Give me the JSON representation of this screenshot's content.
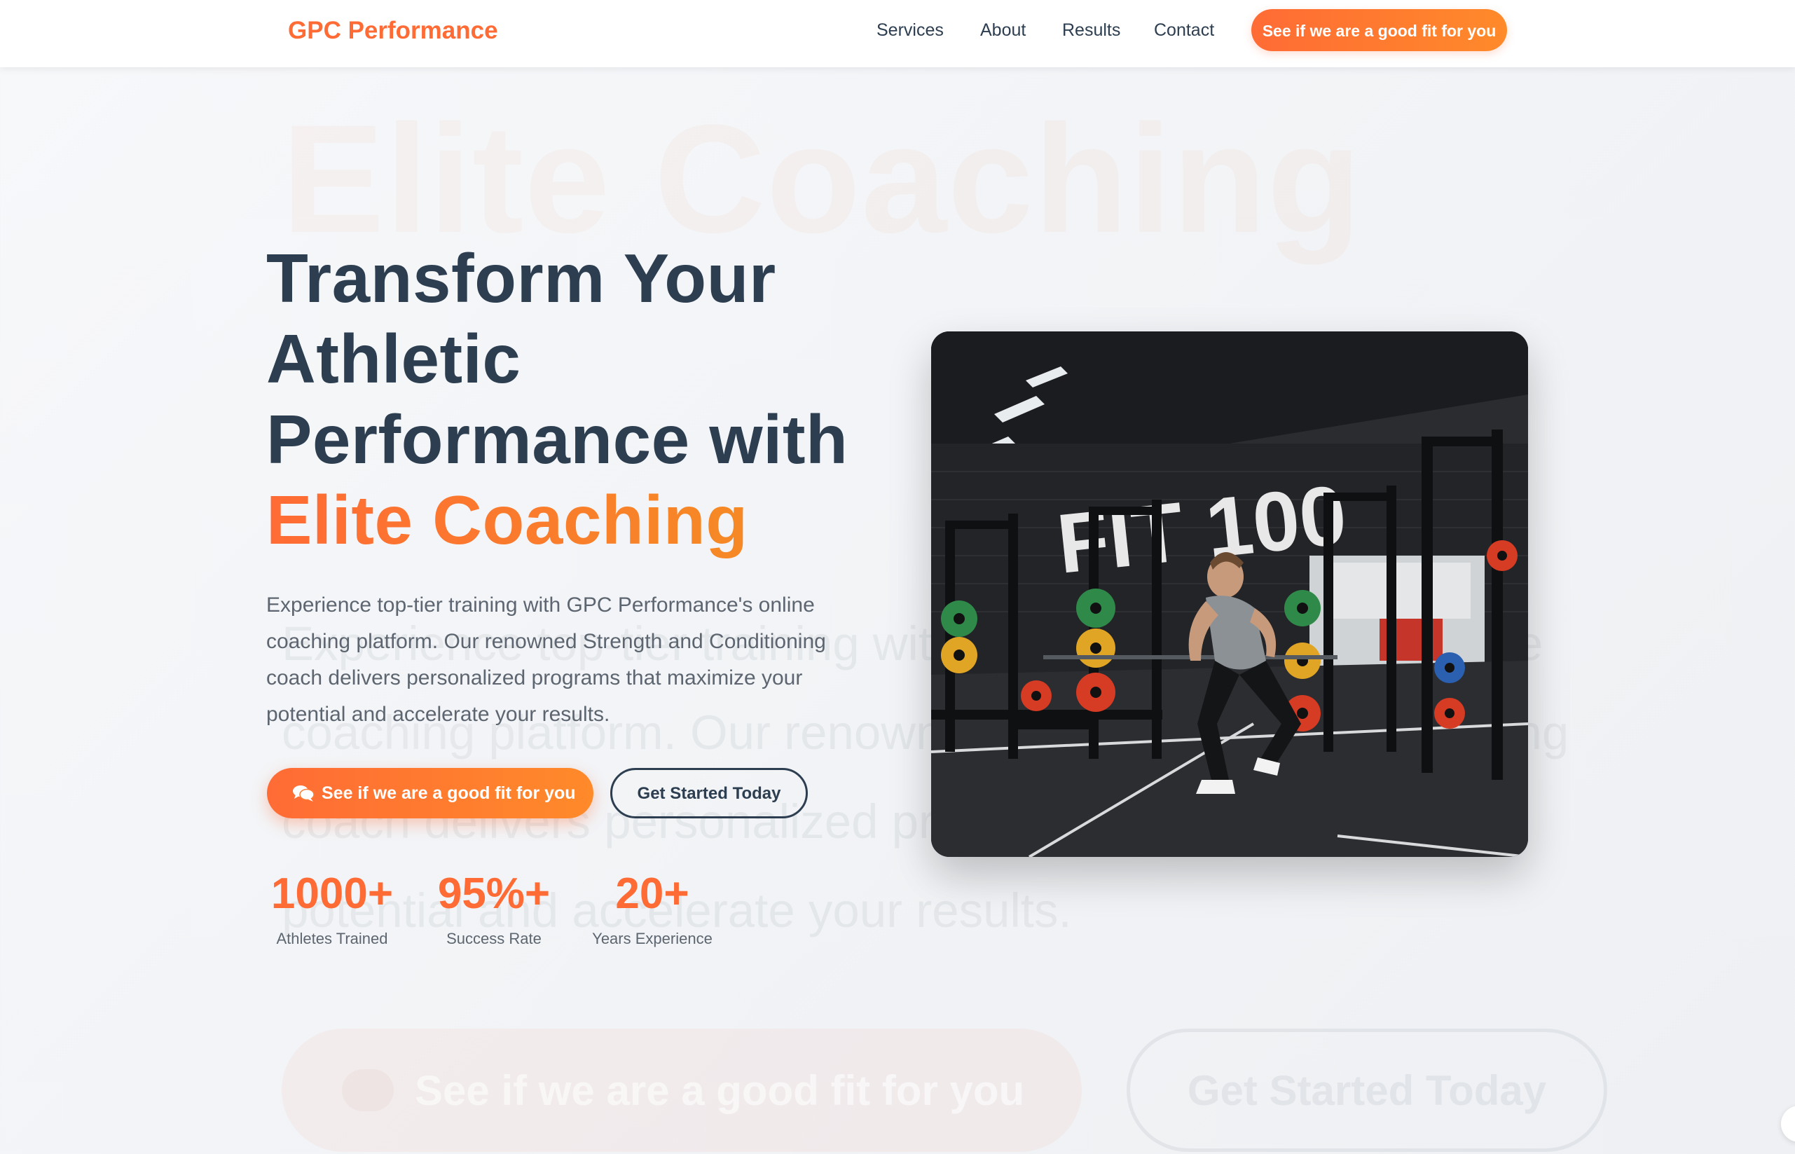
{
  "header": {
    "logo": "GPC Performance",
    "nav": [
      "Services",
      "About",
      "Results",
      "Contact"
    ],
    "cta_label": "See if we are a good fit for you"
  },
  "hero": {
    "title_lines": [
      "Transform Your",
      "Athletic",
      "Performance with"
    ],
    "title_accent": "Elite Coaching",
    "description": "Experience top-tier training with GPC Performance's online coaching platform. Our renowned Strength and Conditioning coach delivers personalized programs that maximize your potential and accelerate your results.",
    "primary_button": "See if we are a good fit for you",
    "secondary_button": "Get Started Today",
    "image_signage": "FIT 100",
    "stats": [
      {
        "value": "1000+",
        "label": "Athletes Trained"
      },
      {
        "value": "95%+",
        "label": "Success Rate"
      },
      {
        "value": "20+",
        "label": "Years Experience"
      }
    ]
  },
  "colors": {
    "accent": "#ff6b35",
    "accent_end": "#ff8a2a",
    "heading": "#2c3e50",
    "body_text": "#5d6670",
    "header_bg": "#ffffff"
  },
  "icons": {
    "primary_button_icon": "chat-bubbles-icon"
  }
}
